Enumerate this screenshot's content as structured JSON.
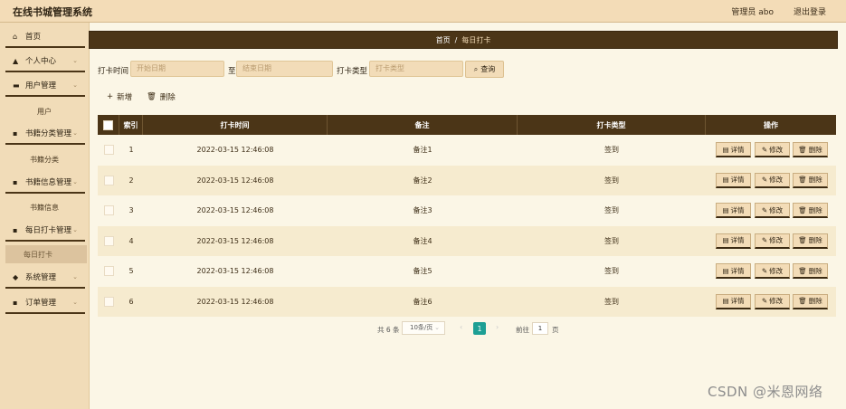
{
  "header": {
    "title": "在线书城管理系统",
    "admin": "管理员 abo",
    "logout": "退出登录"
  },
  "sidebar": {
    "items": [
      {
        "label": "首页",
        "icon": "home-icon",
        "glyph": "⌂"
      },
      {
        "label": "个人中心",
        "icon": "person-icon",
        "glyph": "▲"
      },
      {
        "label": "用户管理",
        "icon": "card-icon",
        "glyph": "▬"
      },
      {
        "label": "用户",
        "sub": true
      },
      {
        "label": "书籍分类管理",
        "icon": "grid-icon",
        "glyph": "▪"
      },
      {
        "label": "书籍分类",
        "sub": true
      },
      {
        "label": "书籍信息管理",
        "icon": "grid-icon",
        "glyph": "▪"
      },
      {
        "label": "书籍信息",
        "sub": true
      },
      {
        "label": "每日打卡管理",
        "icon": "grid-icon",
        "glyph": "▪"
      },
      {
        "label": "每日打卡",
        "sub": true,
        "active": true
      },
      {
        "label": "系统管理",
        "icon": "stack-icon",
        "glyph": "◆"
      },
      {
        "label": "订单管理",
        "icon": "grid-icon",
        "glyph": "▪"
      }
    ]
  },
  "breadcrumb": {
    "home": "首页",
    "sep": "/",
    "current": "每日打卡"
  },
  "filters": {
    "time_label": "打卡时间",
    "start_placeholder": "开始日期",
    "to_label": "至",
    "end_placeholder": "结束日期",
    "type_label": "打卡类型",
    "type_placeholder": "打卡类型",
    "search": "查询"
  },
  "actions": {
    "add": "新增",
    "delete": "删除"
  },
  "table": {
    "columns": [
      "索引",
      "打卡时间",
      "备注",
      "打卡类型",
      "操作"
    ],
    "rows": [
      {
        "index": "1",
        "time": "2022-03-15 12:46:08",
        "note": "备注1",
        "type": "签到"
      },
      {
        "index": "2",
        "time": "2022-03-15 12:46:08",
        "note": "备注2",
        "type": "签到"
      },
      {
        "index": "3",
        "time": "2022-03-15 12:46:08",
        "note": "备注3",
        "type": "签到"
      },
      {
        "index": "4",
        "time": "2022-03-15 12:46:08",
        "note": "备注4",
        "type": "签到"
      },
      {
        "index": "5",
        "time": "2022-03-15 12:46:08",
        "note": "备注5",
        "type": "签到"
      },
      {
        "index": "6",
        "time": "2022-03-15 12:46:08",
        "note": "备注6",
        "type": "签到"
      }
    ],
    "op_labels": {
      "detail": "详情",
      "edit": "修改",
      "delete": "删除"
    }
  },
  "pagination": {
    "total": "共 6 条",
    "page_size": "10条/页",
    "current_page": "1",
    "goto_label": "前往",
    "goto_value": "1",
    "page_unit": "页"
  },
  "watermark": "CSDN @米恩网络",
  "colors": {
    "accent": "#4b3517",
    "sidebar": "#f1dcb8",
    "page_active": "#1d9f94"
  }
}
